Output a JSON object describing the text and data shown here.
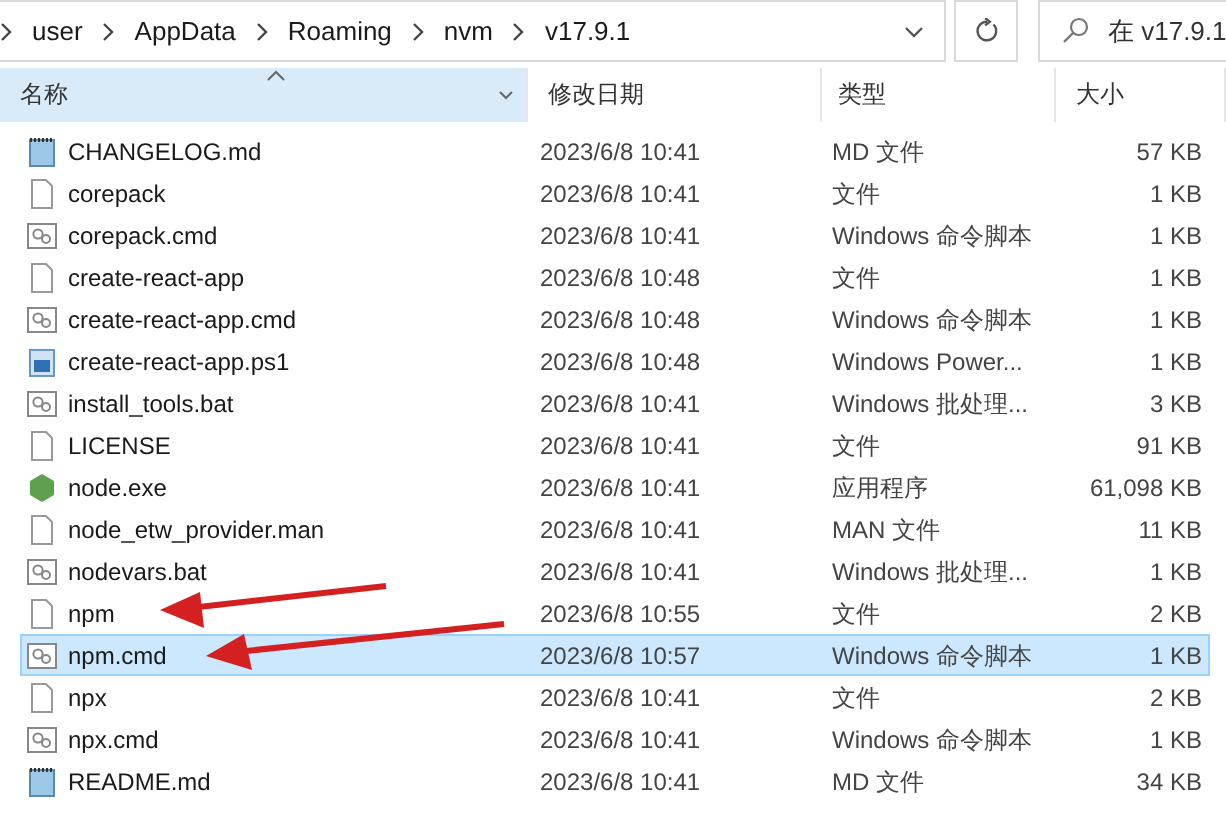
{
  "address": {
    "segments": [
      "user",
      "AppData",
      "Roaming",
      "nvm",
      "v17.9.1"
    ]
  },
  "search": {
    "placeholder": "在 v17.9.1"
  },
  "columns": [
    {
      "label": "名称",
      "selected": true
    },
    {
      "label": "修改日期",
      "selected": false
    },
    {
      "label": "类型",
      "selected": false
    },
    {
      "label": "大小",
      "selected": false
    }
  ],
  "rows": [
    {
      "name": "CHANGELOG.md",
      "date": "2023/6/8 10:41",
      "type": "MD 文件",
      "size": "57 KB",
      "kind": "md",
      "selected": false
    },
    {
      "name": "corepack",
      "date": "2023/6/8 10:41",
      "type": "文件",
      "size": "1 KB",
      "kind": "file",
      "selected": false
    },
    {
      "name": "corepack.cmd",
      "date": "2023/6/8 10:41",
      "type": "Windows 命令脚本",
      "size": "1 KB",
      "kind": "script",
      "selected": false
    },
    {
      "name": "create-react-app",
      "date": "2023/6/8 10:48",
      "type": "文件",
      "size": "1 KB",
      "kind": "file",
      "selected": false
    },
    {
      "name": "create-react-app.cmd",
      "date": "2023/6/8 10:48",
      "type": "Windows 命令脚本",
      "size": "1 KB",
      "kind": "script",
      "selected": false
    },
    {
      "name": "create-react-app.ps1",
      "date": "2023/6/8 10:48",
      "type": "Windows Power...",
      "size": "1 KB",
      "kind": "ps1",
      "selected": false
    },
    {
      "name": "install_tools.bat",
      "date": "2023/6/8 10:41",
      "type": "Windows 批处理...",
      "size": "3 KB",
      "kind": "script",
      "selected": false
    },
    {
      "name": "LICENSE",
      "date": "2023/6/8 10:41",
      "type": "文件",
      "size": "91 KB",
      "kind": "file",
      "selected": false
    },
    {
      "name": "node.exe",
      "date": "2023/6/8 10:41",
      "type": "应用程序",
      "size": "61,098 KB",
      "kind": "exe",
      "selected": false
    },
    {
      "name": "node_etw_provider.man",
      "date": "2023/6/8 10:41",
      "type": "MAN 文件",
      "size": "11 KB",
      "kind": "file",
      "selected": false
    },
    {
      "name": "nodevars.bat",
      "date": "2023/6/8 10:41",
      "type": "Windows 批处理...",
      "size": "1 KB",
      "kind": "script",
      "selected": false
    },
    {
      "name": "npm",
      "date": "2023/6/8 10:55",
      "type": "文件",
      "size": "2 KB",
      "kind": "file",
      "selected": false
    },
    {
      "name": "npm.cmd",
      "date": "2023/6/8 10:57",
      "type": "Windows 命令脚本",
      "size": "1 KB",
      "kind": "script",
      "selected": true
    },
    {
      "name": "npx",
      "date": "2023/6/8 10:41",
      "type": "文件",
      "size": "2 KB",
      "kind": "file",
      "selected": false
    },
    {
      "name": "npx.cmd",
      "date": "2023/6/8 10:41",
      "type": "Windows 命令脚本",
      "size": "1 KB",
      "kind": "script",
      "selected": false
    },
    {
      "name": "README.md",
      "date": "2023/6/8 10:41",
      "type": "MD 文件",
      "size": "34 KB",
      "kind": "md",
      "selected": false
    }
  ]
}
